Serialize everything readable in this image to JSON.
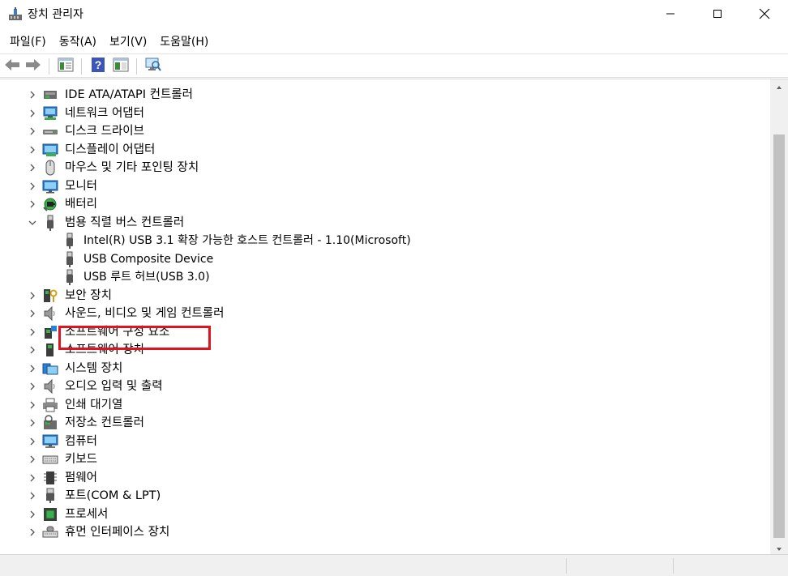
{
  "window": {
    "title": "장치 관리자"
  },
  "menu": [
    {
      "label": "파일(F)"
    },
    {
      "label": "동작(A)"
    },
    {
      "label": "보기(V)"
    },
    {
      "label": "도움말(H)"
    }
  ],
  "toolbar": {
    "buttons": [
      "back-arrow-icon",
      "forward-arrow-icon",
      "properties-icon",
      "help-icon",
      "view-icon",
      "scan-hardware-icon"
    ]
  },
  "tree": {
    "categories": [
      {
        "label": "IDE ATA/ATAPI 컨트롤러",
        "icon": "ide-controller-icon",
        "expanded": false
      },
      {
        "label": "네트워크 어댑터",
        "icon": "network-adapter-icon",
        "expanded": false
      },
      {
        "label": "디스크 드라이브",
        "icon": "disk-drive-icon",
        "expanded": false
      },
      {
        "label": "디스플레이 어댑터",
        "icon": "display-adapter-icon",
        "expanded": false
      },
      {
        "label": "마우스 및 기타 포인팅 장치",
        "icon": "mouse-icon",
        "expanded": false
      },
      {
        "label": "모니터",
        "icon": "monitor-icon",
        "expanded": false
      },
      {
        "label": "배터리",
        "icon": "battery-icon",
        "expanded": false
      },
      {
        "label": "범용 직렬 버스 컨트롤러",
        "icon": "usb-icon",
        "expanded": true
      },
      {
        "label": "보안 장치",
        "icon": "security-device-icon",
        "expanded": false
      },
      {
        "label": "사운드, 비디오 및 게임 컨트롤러",
        "icon": "sound-icon",
        "expanded": false
      },
      {
        "label": "소프트웨어 구성 요소",
        "icon": "software-component-icon",
        "expanded": false
      },
      {
        "label": "소프트웨어 장치",
        "icon": "software-device-icon",
        "expanded": false
      },
      {
        "label": "시스템 장치",
        "icon": "system-device-icon",
        "expanded": false
      },
      {
        "label": "오디오 입력 및 출력",
        "icon": "audio-io-icon",
        "expanded": false
      },
      {
        "label": "인쇄 대기열",
        "icon": "print-queue-icon",
        "expanded": false
      },
      {
        "label": "저장소 컨트롤러",
        "icon": "storage-controller-icon",
        "expanded": false
      },
      {
        "label": "컴퓨터",
        "icon": "computer-icon",
        "expanded": false
      },
      {
        "label": "키보드",
        "icon": "keyboard-icon",
        "expanded": false
      },
      {
        "label": "펌웨어",
        "icon": "firmware-icon",
        "expanded": false
      },
      {
        "label": "포트(COM & LPT)",
        "icon": "port-icon",
        "expanded": false
      },
      {
        "label": "프로세서",
        "icon": "processor-icon",
        "expanded": false
      },
      {
        "label": "휴먼 인터페이스 장치",
        "icon": "hid-icon",
        "expanded": false
      }
    ],
    "usb_children": [
      {
        "label": "Intel(R) USB 3.1 확장 가능한 호스트 컨트롤러 - 1.10(Microsoft)",
        "icon": "usb-device-icon"
      },
      {
        "label": "USB Composite Device",
        "icon": "usb-device-icon",
        "highlighted": true
      },
      {
        "label": "USB 루트 허브(USB 3.0)",
        "icon": "usb-device-icon"
      }
    ]
  },
  "colors": {
    "highlight_border": "#e0141e",
    "scrollbar_track": "#f0f0f0",
    "scrollbar_thumb": "#c1c1c1"
  }
}
